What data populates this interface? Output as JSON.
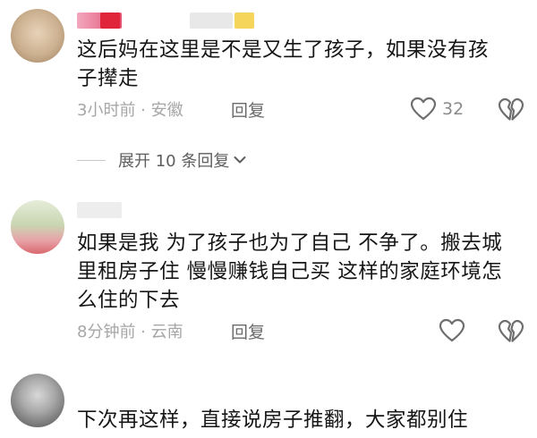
{
  "comments": [
    {
      "text": "这后妈在这里是不是又生了孩子，如果没有孩子撵走",
      "time": "3小时前",
      "location": "安徽",
      "reply_label": "回复",
      "likes": "32"
    },
    {
      "text": "如果是我 为了孩子也为了自己 不争了。搬去城里租房子住 慢慢赚钱自己买 这样的家庭环境怎么住的下去",
      "time": "8分钟前",
      "location": "云南",
      "reply_label": "回复",
      "likes": ""
    },
    {
      "text": "下次再这样，直接说房子推翻，大家都别住"
    }
  ],
  "expand_replies": "展开 10 条回复",
  "meta_separator": " · ",
  "icons": {
    "like": "heart-outline",
    "dislike": "broken-heart-outline",
    "expand": "chevron-down"
  },
  "colors": {
    "text": "#161616",
    "meta": "#a6a6a6",
    "reply": "#6a6a6a",
    "icon": "#6e6e6e"
  }
}
